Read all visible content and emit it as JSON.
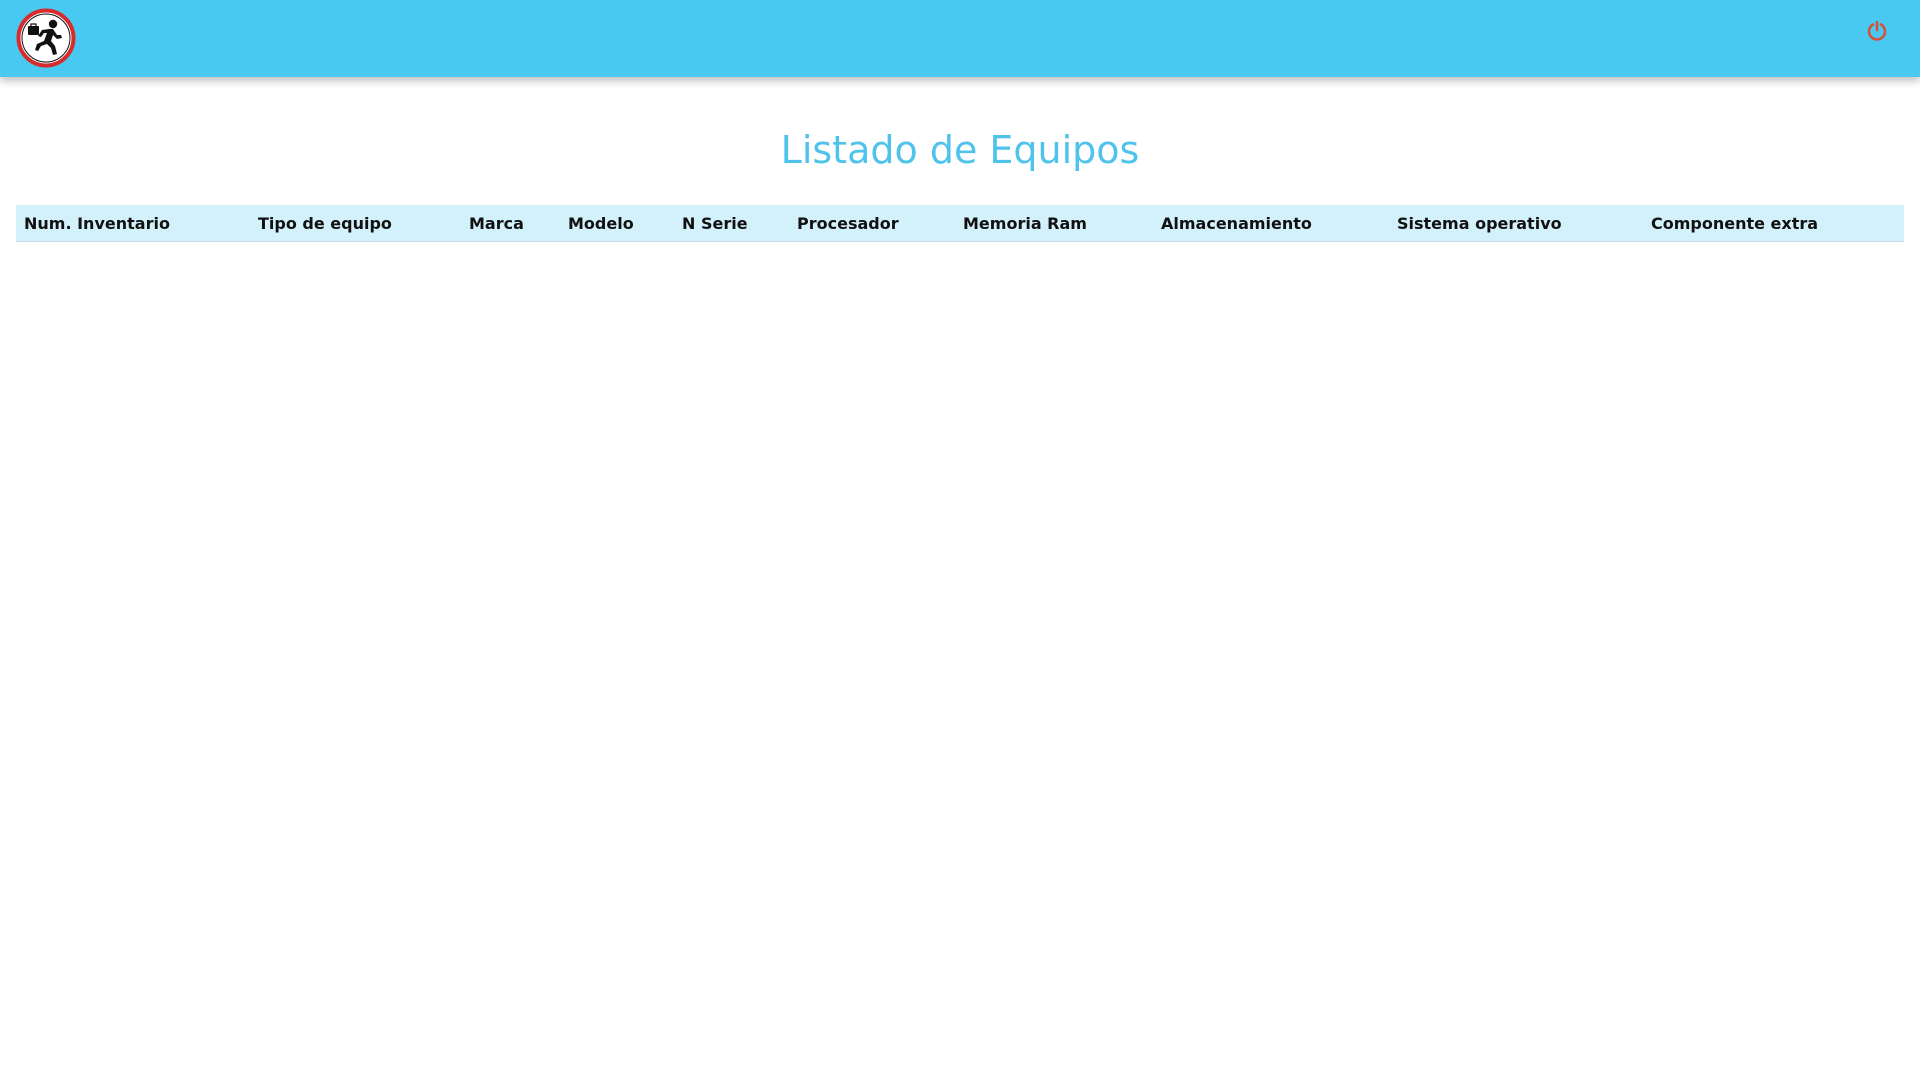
{
  "header": {
    "logo_icon": "running-person-logo-icon",
    "logout_icon": "power-icon",
    "bar_color": "#48c9f2",
    "logo_ring_color": "#d62c2c",
    "logout_color": "#d6503c"
  },
  "main": {
    "title": "Listado de Equipos",
    "title_color": "#4fc3ec"
  },
  "table": {
    "header_bg": "#d3f1fb",
    "columns": [
      "Num. Inventario",
      "Tipo de equipo",
      "Marca",
      "Modelo",
      "N Serie",
      "Procesador",
      "Memoria Ram",
      "Almacenamiento",
      "Sistema operativo",
      "Componente extra"
    ],
    "rows": []
  }
}
